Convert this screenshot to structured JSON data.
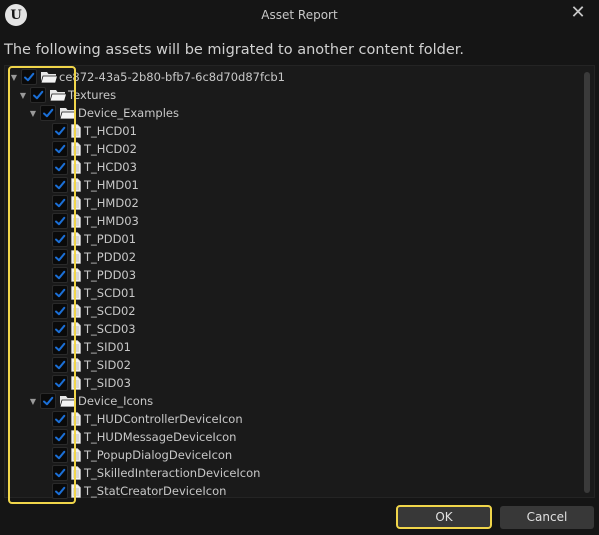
{
  "window": {
    "title": "Asset Report",
    "app_logo_glyph": "U",
    "close_glyph": "✕"
  },
  "message": "The following assets will be migrated to another content folder.",
  "accent_color": "#1b6fd6",
  "highlight_color": "#f0d54a",
  "tree": {
    "root": {
      "label": "ce872-43a5-2b80-bfb7-6c8d70d87fcb1",
      "checked": true,
      "expanded": true
    },
    "textures": {
      "label": "Textures",
      "checked": true,
      "expanded": true
    },
    "device_examples": {
      "label": "Device_Examples",
      "checked": true,
      "expanded": true
    },
    "examples_items": [
      {
        "label": "T_HCD01",
        "checked": true
      },
      {
        "label": "T_HCD02",
        "checked": true
      },
      {
        "label": "T_HCD03",
        "checked": true
      },
      {
        "label": "T_HMD01",
        "checked": true
      },
      {
        "label": "T_HMD02",
        "checked": true
      },
      {
        "label": "T_HMD03",
        "checked": true
      },
      {
        "label": "T_PDD01",
        "checked": true
      },
      {
        "label": "T_PDD02",
        "checked": true
      },
      {
        "label": "T_PDD03",
        "checked": true
      },
      {
        "label": "T_SCD01",
        "checked": true
      },
      {
        "label": "T_SCD02",
        "checked": true
      },
      {
        "label": "T_SCD03",
        "checked": true
      },
      {
        "label": "T_SID01",
        "checked": true
      },
      {
        "label": "T_SID02",
        "checked": true
      },
      {
        "label": "T_SID03",
        "checked": true
      }
    ],
    "device_icons": {
      "label": "Device_Icons",
      "checked": true,
      "expanded": true
    },
    "icons_items": [
      {
        "label": "T_HUDControllerDeviceIcon",
        "checked": true
      },
      {
        "label": "T_HUDMessageDeviceIcon",
        "checked": true
      },
      {
        "label": "T_PopupDialogDeviceIcon",
        "checked": true
      },
      {
        "label": "T_SkilledInteractionDeviceIcon",
        "checked": true
      },
      {
        "label": "T_StatCreatorDeviceIcon",
        "checked": true
      }
    ]
  },
  "buttons": {
    "ok": "OK",
    "cancel": "Cancel"
  }
}
